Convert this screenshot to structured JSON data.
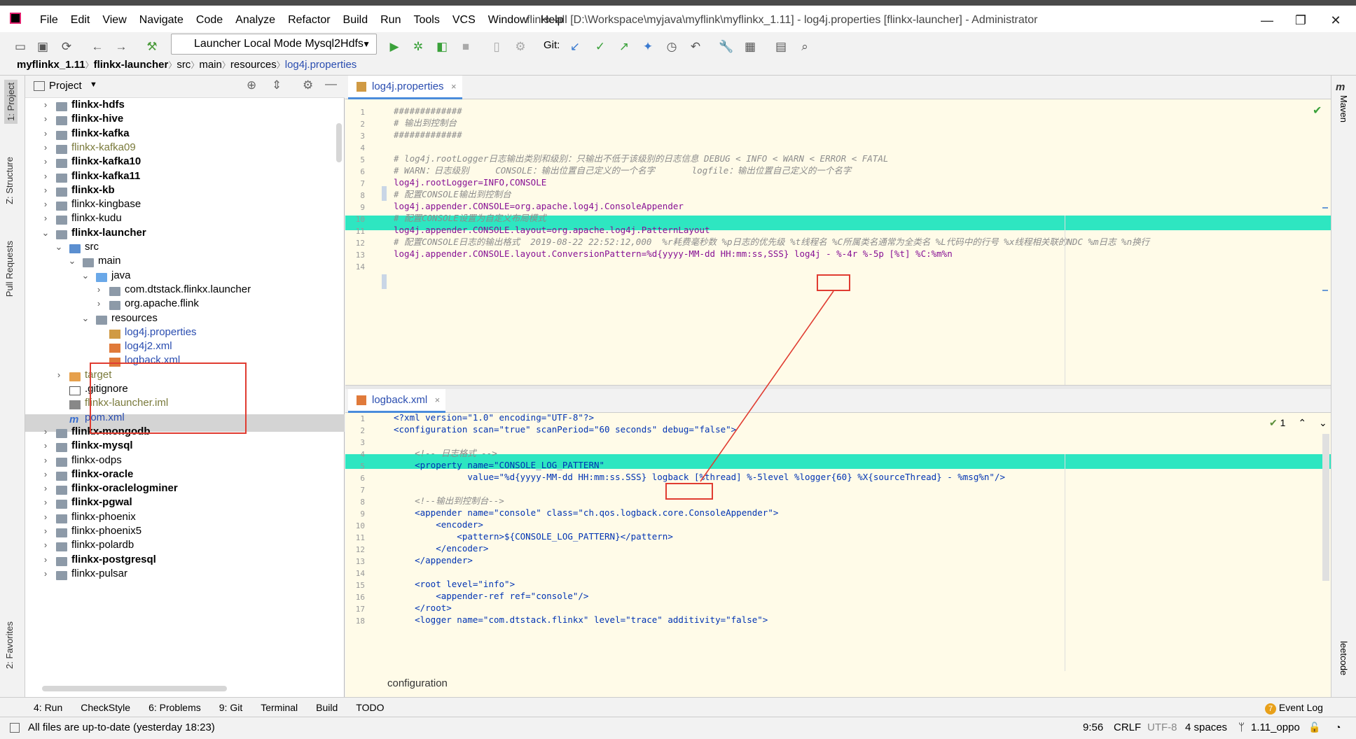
{
  "titlebar": {
    "menu": [
      "File",
      "Edit",
      "View",
      "Navigate",
      "Code",
      "Analyze",
      "Refactor",
      "Build",
      "Run",
      "Tools",
      "VCS",
      "Window",
      "Help"
    ],
    "title": "flinkx-all [D:\\Workspace\\myjava\\myflink\\myflinkx_1.11] - log4j.properties [flinkx-launcher] - Administrator"
  },
  "toolbar": {
    "run_config": "Launcher Local Mode Mysql2Hdfs",
    "git_label": "Git:"
  },
  "breadcrumb": [
    "myflinkx_1.11",
    "flinkx-launcher",
    "src",
    "main",
    "resources",
    "log4j.properties"
  ],
  "left_strip": [
    "1: Project",
    "Z: Structure",
    "Pull Requests",
    "2: Favorites"
  ],
  "right_strip": [
    "Maven",
    "leetcode"
  ],
  "project": {
    "header": "Project",
    "tree": [
      {
        "label": "flinkx-hdfs",
        "style": "b"
      },
      {
        "label": "flinkx-hive",
        "style": "b"
      },
      {
        "label": "flinkx-kafka",
        "style": "b"
      },
      {
        "label": "flinkx-kafka09",
        "style": "olive"
      },
      {
        "label": "flinkx-kafka10",
        "style": "b"
      },
      {
        "label": "flinkx-kafka11",
        "style": "b"
      },
      {
        "label": "flinkx-kb",
        "style": "b"
      },
      {
        "label": "flinkx-kingbase",
        "style": ""
      },
      {
        "label": "flinkx-kudu",
        "style": ""
      },
      {
        "label": "flinkx-launcher",
        "style": "b"
      },
      {
        "label": "src",
        "style": ""
      },
      {
        "label": "main",
        "style": ""
      },
      {
        "label": "java",
        "style": ""
      },
      {
        "label": "com.dtstack.flinkx.launcher",
        "style": ""
      },
      {
        "label": "org.apache.flink",
        "style": ""
      },
      {
        "label": "resources",
        "style": ""
      },
      {
        "label": "log4j.properties",
        "style": "blue"
      },
      {
        "label": "log4j2.xml",
        "style": "blue"
      },
      {
        "label": "logback.xml",
        "style": "blue"
      },
      {
        "label": "target",
        "style": "olive"
      },
      {
        "label": ".gitignore",
        "style": ""
      },
      {
        "label": "flinkx-launcher.iml",
        "style": "olive"
      },
      {
        "label": "pom.xml",
        "style": "blue"
      },
      {
        "label": "flinkx-mongodb",
        "style": "b"
      },
      {
        "label": "flinkx-mysql",
        "style": "b"
      },
      {
        "label": "flinkx-odps",
        "style": ""
      },
      {
        "label": "flinkx-oracle",
        "style": "b"
      },
      {
        "label": "flinkx-oraclelogminer",
        "style": "b"
      },
      {
        "label": "flinkx-pgwal",
        "style": "b"
      },
      {
        "label": "flinkx-phoenix",
        "style": ""
      },
      {
        "label": "flinkx-phoenix5",
        "style": ""
      },
      {
        "label": "flinkx-polardb",
        "style": ""
      },
      {
        "label": "flinkx-postgresql",
        "style": "b"
      },
      {
        "label": "flinkx-pulsar",
        "style": ""
      }
    ]
  },
  "editor_top": {
    "tab": "log4j.properties",
    "lines": [
      "#############",
      "# 输出到控制台",
      "#############",
      "",
      "# log4j.rootLogger日志输出类别和级别：只输出不低于该级别的日志信息 DEBUG < INFO < WARN < ERROR < FATAL",
      "# WARN：日志级别     CONSOLE：输出位置自己定义的一个名字       logfile：输出位置自己定义的一个名字",
      "log4j.rootLogger=INFO,CONSOLE",
      "# 配置CONSOLE输出到控制台",
      "log4j.appender.CONSOLE=org.apache.log4j.ConsoleAppender",
      "# 配置CONSOLE设置为自定义布局模式",
      "log4j.appender.CONSOLE.layout=org.apache.log4j.PatternLayout",
      "# 配置CONSOLE日志的输出格式  2019-08-22 22:52:12,000  %r耗费毫秒数 %p日志的优先级 %t线程名 %C所属类名通常为全类名 %L代码中的行号 %x线程相关联的NDC %m日志 %n换行",
      "log4j.appender.CONSOLE.layout.ConversionPattern=%d{yyyy-MM-dd HH:mm:ss,SSS} log4j - %-4r %-5p [%t] %C:%m%n",
      ""
    ]
  },
  "editor_bottom": {
    "tab": "logback.xml",
    "inspection": "1",
    "lines": [
      "<?xml version=\"1.0\" encoding=\"UTF-8\"?>",
      "<configuration scan=\"true\" scanPeriod=\"60 seconds\" debug=\"false\">",
      "",
      "    <!-- 日志格式 -->",
      "    <property name=\"CONSOLE_LOG_PATTERN\"",
      "              value=\"%d{yyyy-MM-dd HH:mm:ss.SSS} logback [%thread] %-5level %logger{60} %X{sourceThread} - %msg%n\"/>",
      "",
      "    <!--输出到控制台-->",
      "    <appender name=\"console\" class=\"ch.qos.logback.core.ConsoleAppender\">",
      "        <encoder>",
      "            <pattern>${CONSOLE_LOG_PATTERN}</pattern>",
      "        </encoder>",
      "    </appender>",
      "",
      "    <root level=\"info\">",
      "        <appender-ref ref=\"console\"/>",
      "    </root>",
      "    <logger name=\"com.dtstack.flinkx\" level=\"trace\" additivity=\"false\">"
    ],
    "footer_crumb": "configuration"
  },
  "bottom_tabs": [
    "4: Run",
    "CheckStyle",
    "6: Problems",
    "9: Git",
    "Terminal",
    "Build",
    "TODO"
  ],
  "event_log": "Event Log",
  "event_count": "7",
  "status": {
    "message": "All files are up-to-date (yesterday 18:23)",
    "position": "9:56",
    "line_sep": "CRLF",
    "encoding": "UTF-8",
    "indent": "4 spaces",
    "branch": "1.11_oppo"
  },
  "colors": {
    "highlight": "#2ee6c1",
    "annotation": "#e03c31",
    "editor_bg": "#fffbe8"
  }
}
